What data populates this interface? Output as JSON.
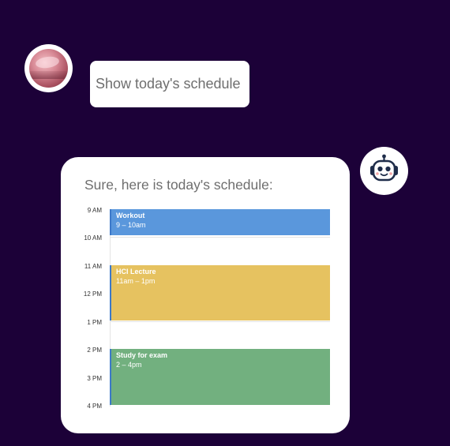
{
  "conversation": {
    "user_message": "Show today's schedule",
    "bot_message": "Sure, here is today's schedule:"
  },
  "avatars": {
    "user": "user-avatar",
    "bot": "robot-icon"
  },
  "calendar": {
    "time_labels": [
      "9 AM",
      "10 AM",
      "11 AM",
      "12 PM",
      "1 PM",
      "2 PM",
      "3 PM",
      "4 PM"
    ],
    "events": [
      {
        "title": "Workout",
        "time": "9 – 10am",
        "color": "#5a97dc"
      },
      {
        "title": "HCI Lecture",
        "time": "11am – 1pm",
        "color": "#e6c260"
      },
      {
        "title": "Study for exam",
        "time": "2 – 4pm",
        "color": "#72b07f"
      }
    ]
  },
  "colors": {
    "background": "#1c0138",
    "bubble": "#ffffff",
    "text": "#6e6e6e"
  }
}
